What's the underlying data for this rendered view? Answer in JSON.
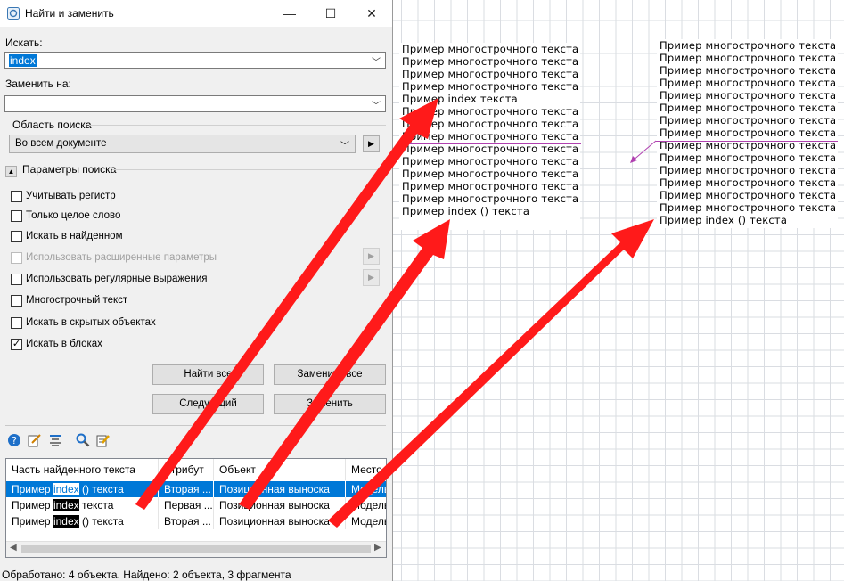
{
  "dialog": {
    "title": "Найти и заменить",
    "find_label": "Искать:",
    "find_value": "index",
    "replace_label": "Заменить на:",
    "replace_value": "",
    "scope_group": "Область поиска",
    "scope_value": "Во всем документе",
    "params_group": "Параметры поиска",
    "options": [
      {
        "label": "Учитывать регистр",
        "checked": false,
        "enabled": true
      },
      {
        "label": "Только целое слово",
        "checked": false,
        "enabled": true
      },
      {
        "label": "Искать в найденном",
        "checked": false,
        "enabled": true
      },
      {
        "label": "Использовать расширенные параметры",
        "checked": false,
        "enabled": false
      },
      {
        "label": "Использовать регулярные выражения",
        "checked": false,
        "enabled": true
      },
      {
        "label": "Многострочный текст",
        "checked": false,
        "enabled": true
      },
      {
        "label": "Искать в скрытых объектах",
        "checked": false,
        "enabled": true
      },
      {
        "label": "Искать в блоках",
        "checked": true,
        "enabled": true
      }
    ],
    "buttons": {
      "find_all": "Найти все",
      "replace_all": "Заменить все",
      "next": "Следующий",
      "replace": "Заменить"
    },
    "toolbar_icons": [
      "help-icon",
      "edit-icon",
      "align-icon",
      "search-icon",
      "highlight-icon"
    ],
    "results": {
      "columns": [
        "Часть найденного текста",
        "Атрибут",
        "Объект",
        "Место"
      ],
      "rows": [
        {
          "pre": "Пример ",
          "match": "index",
          "post": " () текста",
          "attr": "Вторая ...",
          "object": "Позиционная выноска",
          "place": "Модель",
          "selected": true
        },
        {
          "pre": "Пример ",
          "match": "index",
          "post": " текста",
          "attr": "Первая ...",
          "object": "Позиционная выноска",
          "place": "Модель",
          "selected": false
        },
        {
          "pre": "Пример ",
          "match": "index",
          "post": " () текста",
          "attr": "Вторая ...",
          "object": "Позиционная выноска",
          "place": "Модель",
          "selected": false
        }
      ]
    },
    "status": "Обработано: 4 объекта. Найдено: 2 объекта, 3 фрагмента"
  },
  "canvas": {
    "block1": [
      "Пример многострочного текста",
      "Пример многострочного текста",
      "Пример многострочного текста",
      "Пример многострочного текста",
      "Пример index текста",
      "Пример многострочного текста",
      "Пример многострочного текста",
      "Пример многострочного текста",
      "Пример многострочного текста",
      "Пример многострочного текста",
      "Пример многострочного текста",
      "Пример многострочного текста",
      "Пример многострочного текста",
      "Пример index () текста"
    ],
    "block2": [
      "Пример многострочного текста",
      "Пример многострочного текста",
      "Пример многострочного текста",
      "Пример многострочного текста",
      "Пример многострочного текста",
      "Пример многострочного текста",
      "Пример многострочного текста",
      "Пример многострочного текста",
      "Пример многострочного текста",
      "Пример многострочного текста",
      "Пример многострочного текста",
      "Пример многострочного текста",
      "Пример многострочного текста",
      "Пример многострочного текста",
      "Пример index () текста"
    ]
  },
  "colors": {
    "accent": "#0078d7",
    "annotation_arrow": "#ff0000",
    "leader_line": "#b040b0"
  }
}
